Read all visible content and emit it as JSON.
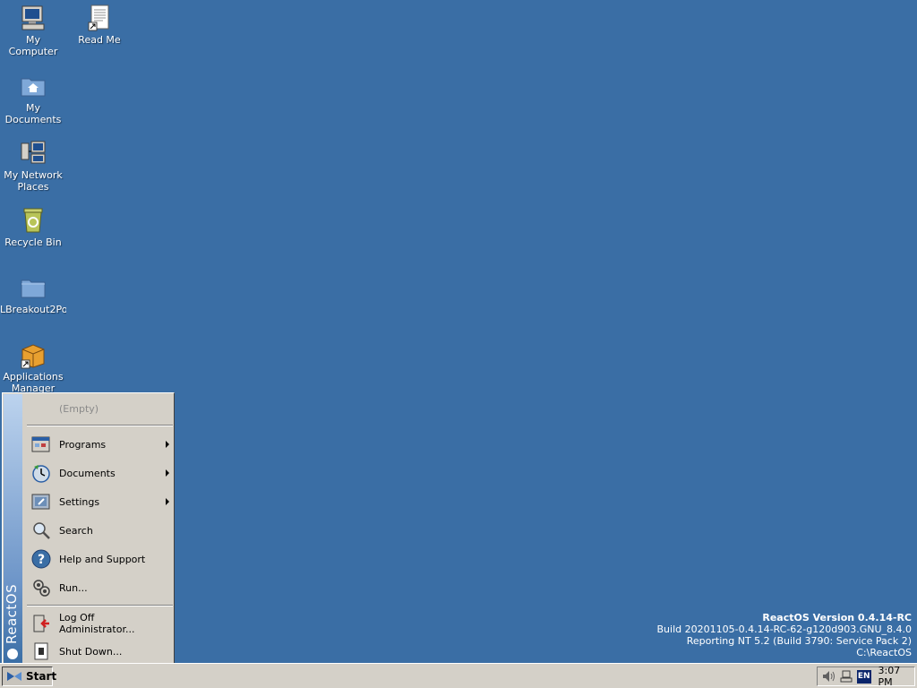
{
  "desktop": {
    "background_color": "#3a6ea5",
    "icons": [
      {
        "label": "My Computer",
        "icon": "computer-icon"
      },
      {
        "label": "Read Me",
        "icon": "document-icon"
      },
      {
        "label": "My Documents",
        "icon": "documents-folder-icon"
      },
      {
        "label": "My Network Places",
        "icon": "network-icon"
      },
      {
        "label": "Recycle Bin",
        "icon": "recycle-bin-icon"
      },
      {
        "label": "LBreakout2Po...",
        "icon": "folder-icon"
      },
      {
        "label": "Applications Manager",
        "icon": "package-icon"
      }
    ]
  },
  "version": {
    "line1": "ReactOS Version 0.4.14-RC",
    "line2": "Build 20201105-0.4.14-RC-62-g120d903.GNU_8.4.0",
    "line3": "Reporting NT 5.2 (Build 3790: Service Pack 2)",
    "line4": "C:\\ReactOS"
  },
  "start_menu": {
    "banner_text": "ReactOS",
    "empty_label": "(Empty)",
    "items": [
      {
        "label": "Programs",
        "icon": "programs-icon",
        "submenu": true
      },
      {
        "label": "Documents",
        "icon": "documents-icon",
        "submenu": true
      },
      {
        "label": "Settings",
        "icon": "settings-icon",
        "submenu": true
      },
      {
        "label": "Search",
        "icon": "search-icon",
        "submenu": false
      },
      {
        "label": "Help and Support",
        "icon": "help-icon",
        "submenu": false
      },
      {
        "label": "Run...",
        "icon": "run-icon",
        "submenu": false
      }
    ],
    "logoff_label": "Log Off Administrator...",
    "shutdown_label": "Shut Down..."
  },
  "taskbar": {
    "start_label": "Start",
    "language": "EN",
    "clock": "3:07 PM"
  }
}
